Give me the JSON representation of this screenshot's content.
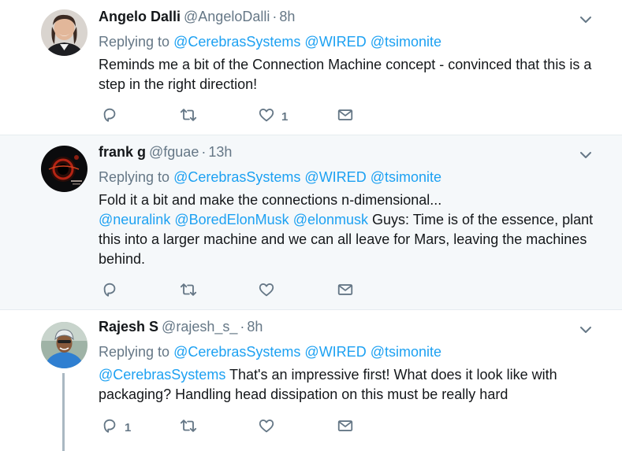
{
  "tweets": [
    {
      "name": "Angelo Dalli",
      "handle": "@AngeloDalli",
      "time": "8h",
      "replying_prefix": "Replying to",
      "replying_to": [
        "@CerebrasSystems",
        "@WIRED",
        "@tsimonite"
      ],
      "body_lines": [
        "Reminds me a bit of the Connection Machine concept - convinced that this is a",
        "step in the right direction!"
      ],
      "reply_count": "",
      "like_count": "1"
    },
    {
      "name": "frank g",
      "handle": "@fguae",
      "time": "13h",
      "replying_prefix": "Replying to",
      "replying_to": [
        "@CerebrasSystems",
        "@WIRED",
        "@tsimonite"
      ],
      "body_line1": "Fold it a bit and make the connections n-dimensional...",
      "mentions": [
        "@neuralink",
        "@BoredElonMusk",
        "@elonmusk"
      ],
      "body_line2_rest": " Guys: Time is of the essence, plant",
      "body_line3": "this into a larger machine and we can all leave for Mars, leaving the machines",
      "body_line4": "behind.",
      "reply_count": "",
      "like_count": ""
    },
    {
      "name": "Rajesh S",
      "handle": "@rajesh_s_",
      "time": "8h",
      "replying_prefix": "Replying to",
      "replying_to": [
        "@CerebrasSystems",
        "@WIRED",
        "@tsimonite"
      ],
      "body_mention": "@CerebrasSystems",
      "body_line1_rest": " That's an impressive first! What does it look like with",
      "body_line2": "packaging? Handling head dissipation on this must be really hard",
      "reply_count": "1",
      "like_count": ""
    }
  ],
  "separator": "·",
  "colors": {
    "link": "#1da1f2",
    "secondary": "#657786",
    "highlight_bg": "#f5f8fa",
    "thread_line": "#aab8c2"
  },
  "icons": [
    "chevron-down-icon",
    "reply-icon",
    "retweet-icon",
    "like-icon",
    "message-icon"
  ]
}
